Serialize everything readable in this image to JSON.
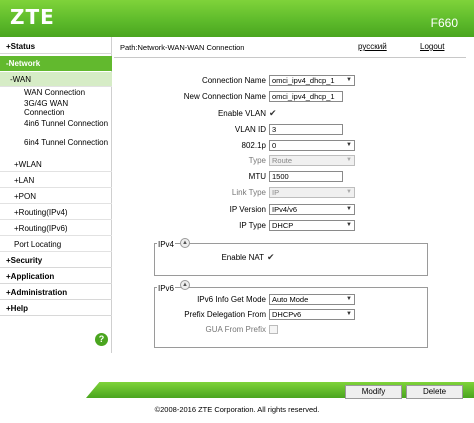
{
  "header": {
    "logo": "ZTE",
    "model": "F660"
  },
  "path": {
    "text": "Path:Network-WAN-WAN Connection",
    "language_link": "русский",
    "logout_link": "Logout"
  },
  "sidebar": {
    "status": "+Status",
    "network": "-Network",
    "wan": "-WAN",
    "wan_connection": "WAN Connection",
    "wan_3g4g": "3G/4G WAN Connection",
    "tunnel_4in6": "4in6 Tunnel Connection",
    "tunnel_6in4": "6in4 Tunnel Connection",
    "wlan": "+WLAN",
    "lan": "+LAN",
    "pon": "+PON",
    "routing_ipv4": "+Routing(IPv4)",
    "routing_ipv6": "+Routing(IPv6)",
    "port_locating": "Port Locating",
    "security": "+Security",
    "application": "+Application",
    "administration": "+Administration",
    "help": "+Help",
    "help_icon": "?"
  },
  "form": {
    "connection_name": {
      "label": "Connection Name",
      "value": "omci_ipv4_dhcp_1"
    },
    "new_connection_name": {
      "label": "New Connection Name",
      "value": "omci_ipv4_dhcp_1"
    },
    "enable_vlan": {
      "label": "Enable VLAN",
      "checked": true
    },
    "vlan_id": {
      "label": "VLAN ID",
      "value": "3"
    },
    "priority_8021p": {
      "label": "802.1p",
      "value": "0"
    },
    "type": {
      "label": "Type",
      "value": "Route"
    },
    "mtu": {
      "label": "MTU",
      "value": "1500"
    },
    "link_type": {
      "label": "Link Type",
      "value": "IP"
    },
    "ip_version": {
      "label": "IP Version",
      "value": "IPv4/v6"
    },
    "ip_type": {
      "label": "IP Type",
      "value": "DHCP"
    }
  },
  "ipv4": {
    "title": "IPv4",
    "enable_nat": {
      "label": "Enable NAT",
      "checked": true
    }
  },
  "ipv6": {
    "title": "IPv6",
    "info_get_mode": {
      "label": "IPv6 Info Get Mode",
      "value": "Auto Mode"
    },
    "prefix_delegation_from": {
      "label": "Prefix Delegation From",
      "value": "DHCPv6"
    },
    "gua_from_prefix": {
      "label": "GUA From Prefix",
      "checked": false
    }
  },
  "buttons": {
    "modify": "Modify",
    "delete": "Delete"
  },
  "footer": {
    "copyright": "©2008-2016 ZTE Corporation. All rights reserved."
  },
  "colors": {
    "brand_green": "#5cb92a",
    "active_nav": "#62b92e"
  }
}
